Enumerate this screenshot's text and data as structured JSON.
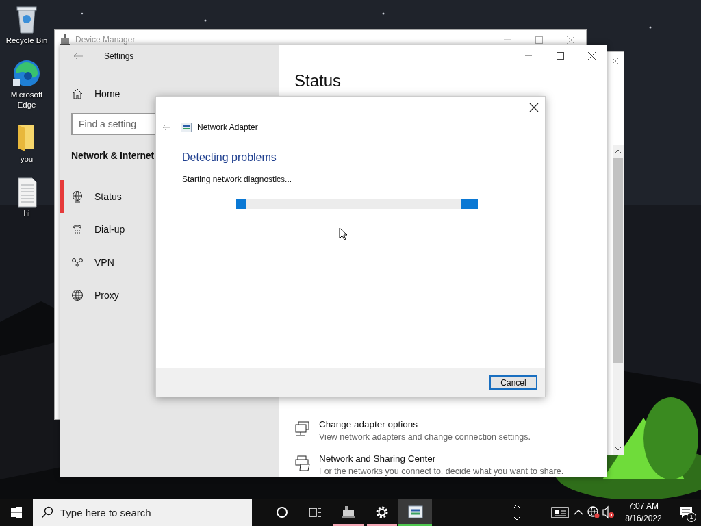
{
  "desktop_icons": [
    {
      "label": "Recycle Bin",
      "kind": "recycle"
    },
    {
      "label": "Microsoft Edge",
      "kind": "edge"
    },
    {
      "label": "you",
      "kind": "folder"
    },
    {
      "label": "hi",
      "kind": "document"
    }
  ],
  "device_manager": {
    "title": "Device Manager"
  },
  "settings": {
    "title": "Settings",
    "home": "Home",
    "search": {
      "placeholder": "Find a setting"
    },
    "section": "Network & Internet",
    "nav_items": [
      {
        "label": "Status",
        "kind": "status",
        "selected": true
      },
      {
        "label": "Dial-up",
        "kind": "dialup",
        "selected": false
      },
      {
        "label": "VPN",
        "kind": "vpn",
        "selected": false
      },
      {
        "label": "Proxy",
        "kind": "proxy",
        "selected": false
      }
    ],
    "page_title": "Status",
    "links": [
      {
        "title": "Change adapter options",
        "description": "View network adapters and change connection settings.",
        "kind": "adapter"
      },
      {
        "title": "Network and Sharing Center",
        "description": "For the networks you connect to, decide what you want to share.",
        "kind": "sharing"
      }
    ]
  },
  "dialog": {
    "title": "Network Adapter",
    "heading": "Detecting problems",
    "message": "Starting network diagnostics...",
    "progress": {
      "indeterminate": true
    },
    "button": "Cancel"
  },
  "taskbar": {
    "search": {
      "placeholder": "Type here to search"
    },
    "apps": [
      {
        "kind": "device-manager",
        "color": "#f4a7b5",
        "selected": false
      },
      {
        "kind": "settings",
        "color": "#f4a7b5",
        "selected": false
      },
      {
        "kind": "network-adapter",
        "color": "#4fc84f",
        "selected": true
      }
    ],
    "time": "7:07 AM",
    "date": "8/16/2022",
    "notifications": "1"
  }
}
